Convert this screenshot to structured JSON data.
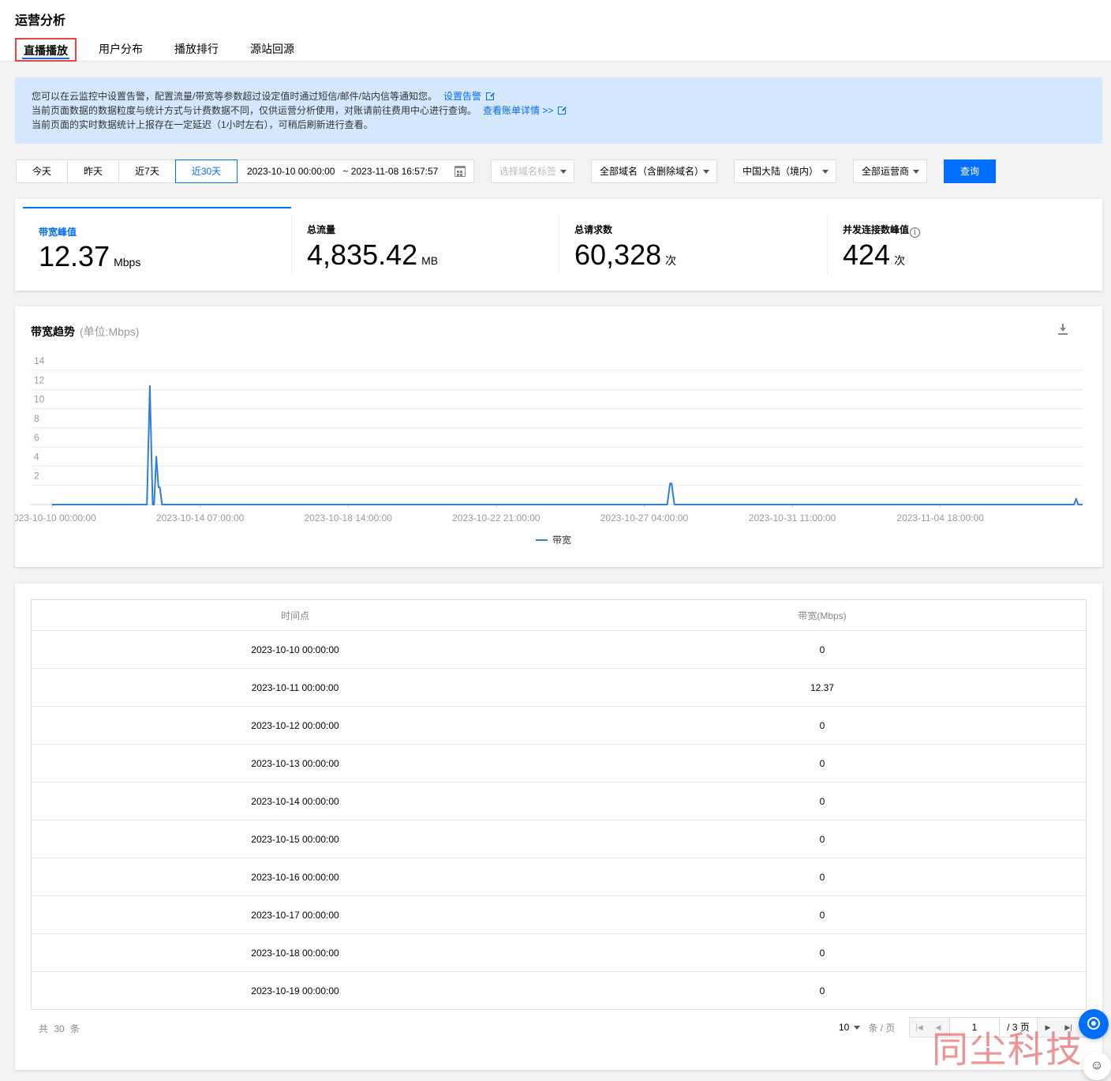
{
  "page": {
    "title": "运营分析"
  },
  "tabs": [
    {
      "label": "直播播放",
      "active": true
    },
    {
      "label": "用户分布",
      "active": false
    },
    {
      "label": "播放排行",
      "active": false
    },
    {
      "label": "源站回源",
      "active": false
    }
  ],
  "notice": {
    "line1": "您可以在云监控中设置告警，配置流量/带宽等参数超过设定值时通过短信/邮件/站内信等通知您。",
    "link1": "设置告警",
    "line2": "当前页面数据的数据粒度与统计方式与计费数据不同，仅供运营分析使用，对账请前往费用中心进行查询。",
    "link2": "查看账单详情 >>",
    "line3": "当前页面的实时数据统计上报存在一定延迟（1小时左右），可稍后刷新进行查看。"
  },
  "toolbar": {
    "ranges": [
      {
        "label": "今天",
        "active": false
      },
      {
        "label": "昨天",
        "active": false
      },
      {
        "label": "近7天",
        "active": false
      },
      {
        "label": "近30天",
        "active": true
      }
    ],
    "date_range": "2023-10-10 00:00:00   ~ 2023-11-08 16:57:57",
    "domain_tag_placeholder": "选择域名标签",
    "domain_select": "全部域名（含删除域名）",
    "region_select": "中国大陆（境内）",
    "isp_select": "全部运营商",
    "query_label": "查询"
  },
  "stats": [
    {
      "label": "带宽峰值",
      "value": "12.37",
      "unit": "Mbps",
      "active": true
    },
    {
      "label": "总流量",
      "value": "4,835.42",
      "unit": "MB",
      "active": false
    },
    {
      "label": "总请求数",
      "value": "60,328",
      "unit": "次",
      "active": false
    },
    {
      "label": "并发连接数峰值",
      "value": "424",
      "unit": "次",
      "active": false,
      "info": "i"
    }
  ],
  "chart_card": {
    "title": "带宽趋势",
    "unit": "(单位:Mbps)"
  },
  "chart_data": {
    "type": "line",
    "title": "带宽趋势",
    "ylabel": "",
    "ylim": [
      0,
      14
    ],
    "yticks": [
      "2",
      "4",
      "6",
      "8",
      "10",
      "12",
      "14"
    ],
    "x_tick_labels": [
      "2023-10-10 00:00:00",
      "2023-10-14 07:00:00",
      "2023-10-18 14:00:00",
      "2023-10-22 21:00:00",
      "2023-10-27 04:00:00",
      "2023-10-31 11:00:00",
      "2023-11-04 18:00:00"
    ],
    "x_unit": "hours since 2023-10-10 00:00:00",
    "series": [
      {
        "name": "带宽",
        "color": "#2f7ed8",
        "points": [
          [
            0,
            0
          ],
          [
            66,
            0
          ],
          [
            68,
            12.37
          ],
          [
            70,
            0
          ],
          [
            71,
            0
          ],
          [
            72.5,
            5
          ],
          [
            74,
            1.8
          ],
          [
            75,
            1.8
          ],
          [
            76.5,
            0
          ],
          [
            428,
            0
          ],
          [
            430,
            2.2
          ],
          [
            431,
            2.2
          ],
          [
            433,
            0
          ],
          [
            711,
            0
          ],
          [
            712.5,
            0.6
          ],
          [
            714,
            0
          ],
          [
            717,
            0
          ]
        ]
      }
    ],
    "grid": true,
    "legend": "bottom-center"
  },
  "table": {
    "headers": [
      "时间点",
      "带宽(Mbps)"
    ],
    "rows": [
      [
        "2023-10-10 00:00:00",
        "0"
      ],
      [
        "2023-10-11 00:00:00",
        "12.37"
      ],
      [
        "2023-10-12 00:00:00",
        "0"
      ],
      [
        "2023-10-13 00:00:00",
        "0"
      ],
      [
        "2023-10-14 00:00:00",
        "0"
      ],
      [
        "2023-10-15 00:00:00",
        "0"
      ],
      [
        "2023-10-16 00:00:00",
        "0"
      ],
      [
        "2023-10-17 00:00:00",
        "0"
      ],
      [
        "2023-10-18 00:00:00",
        "0"
      ],
      [
        "2023-10-19 00:00:00",
        "0"
      ]
    ]
  },
  "pagination": {
    "total": "共 30 条",
    "page_size": "10",
    "per_page_label": "条 / 页",
    "current_page": "1",
    "total_pages": "/ 3 页"
  },
  "watermark": "同尘科技",
  "colors": {
    "accent": "#006eff",
    "notice_bg": "#d5e7ff",
    "line": "#2f7ed8"
  }
}
